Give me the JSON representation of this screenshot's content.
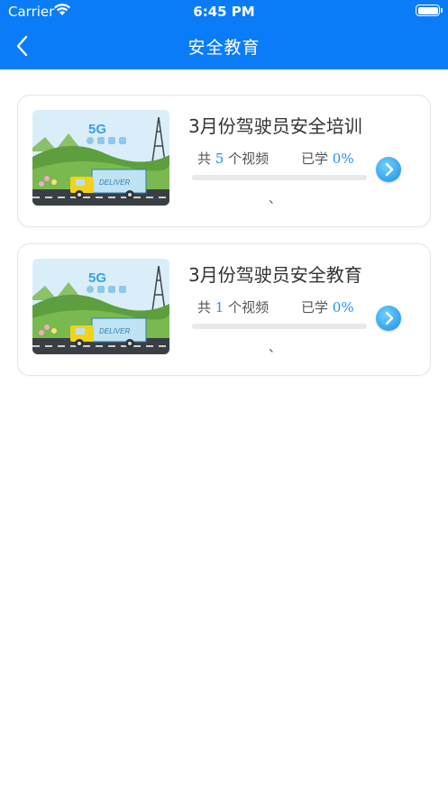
{
  "status_bar": {
    "carrier": "Carrier",
    "time": "6:45 PM"
  },
  "nav": {
    "title": "安全教育",
    "back_icon": "chevron-left-icon"
  },
  "colors": {
    "primary": "#0b7cf7",
    "accent": "#1e90ff",
    "progress_track": "#e9e9e9"
  },
  "courses": [
    {
      "title": "3月份驾驶员安全培训",
      "video_prefix": "共",
      "video_count": "5",
      "video_suffix": "个视频",
      "learned_label": "已学",
      "learned_percent": "0%",
      "progress": 0,
      "mark": "、",
      "thumb_badge": "5G",
      "thumb_truck_text": "DELIVER"
    },
    {
      "title": "3月份驾驶员安全教育",
      "video_prefix": "共",
      "video_count": "1",
      "video_suffix": "个视频",
      "learned_label": "已学",
      "learned_percent": "0%",
      "progress": 0,
      "mark": "、",
      "thumb_badge": "5G",
      "thumb_truck_text": "DELIVER"
    }
  ]
}
